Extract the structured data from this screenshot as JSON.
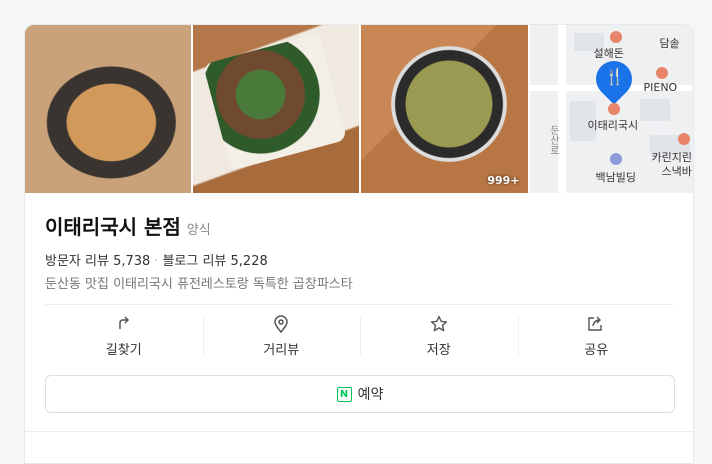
{
  "gallery": {
    "photo_count_badge": "999+",
    "map_labels": {
      "top_right": "담솥",
      "poi_1": "설해돈",
      "poi_2": "PIENO",
      "selected": "이태리국시",
      "poi_3": "카린지린",
      "poi_3b": "스낵바",
      "building": "백남빌딩",
      "road": "둔산로"
    }
  },
  "place": {
    "name": "이태리국시 본점",
    "category": "양식",
    "visitor_review_label": "방문자 리뷰",
    "visitor_review_count": "5,738",
    "separator": "·",
    "blog_review_label": "블로그 리뷰",
    "blog_review_count": "5,228",
    "description": "둔산동 맛집 이태리국시 퓨전레스토랑 독특한 곱창파스타"
  },
  "actions": [
    {
      "label": "길찾기",
      "icon": "directions-icon"
    },
    {
      "label": "거리뷰",
      "icon": "location-pin-icon"
    },
    {
      "label": "저장",
      "icon": "star-icon"
    },
    {
      "label": "공유",
      "icon": "share-icon"
    }
  ],
  "reserve": {
    "icon_letter": "N",
    "label": "예약"
  },
  "colors": {
    "accent_blue": "#1a73e8",
    "naver_green": "#03c75a"
  }
}
